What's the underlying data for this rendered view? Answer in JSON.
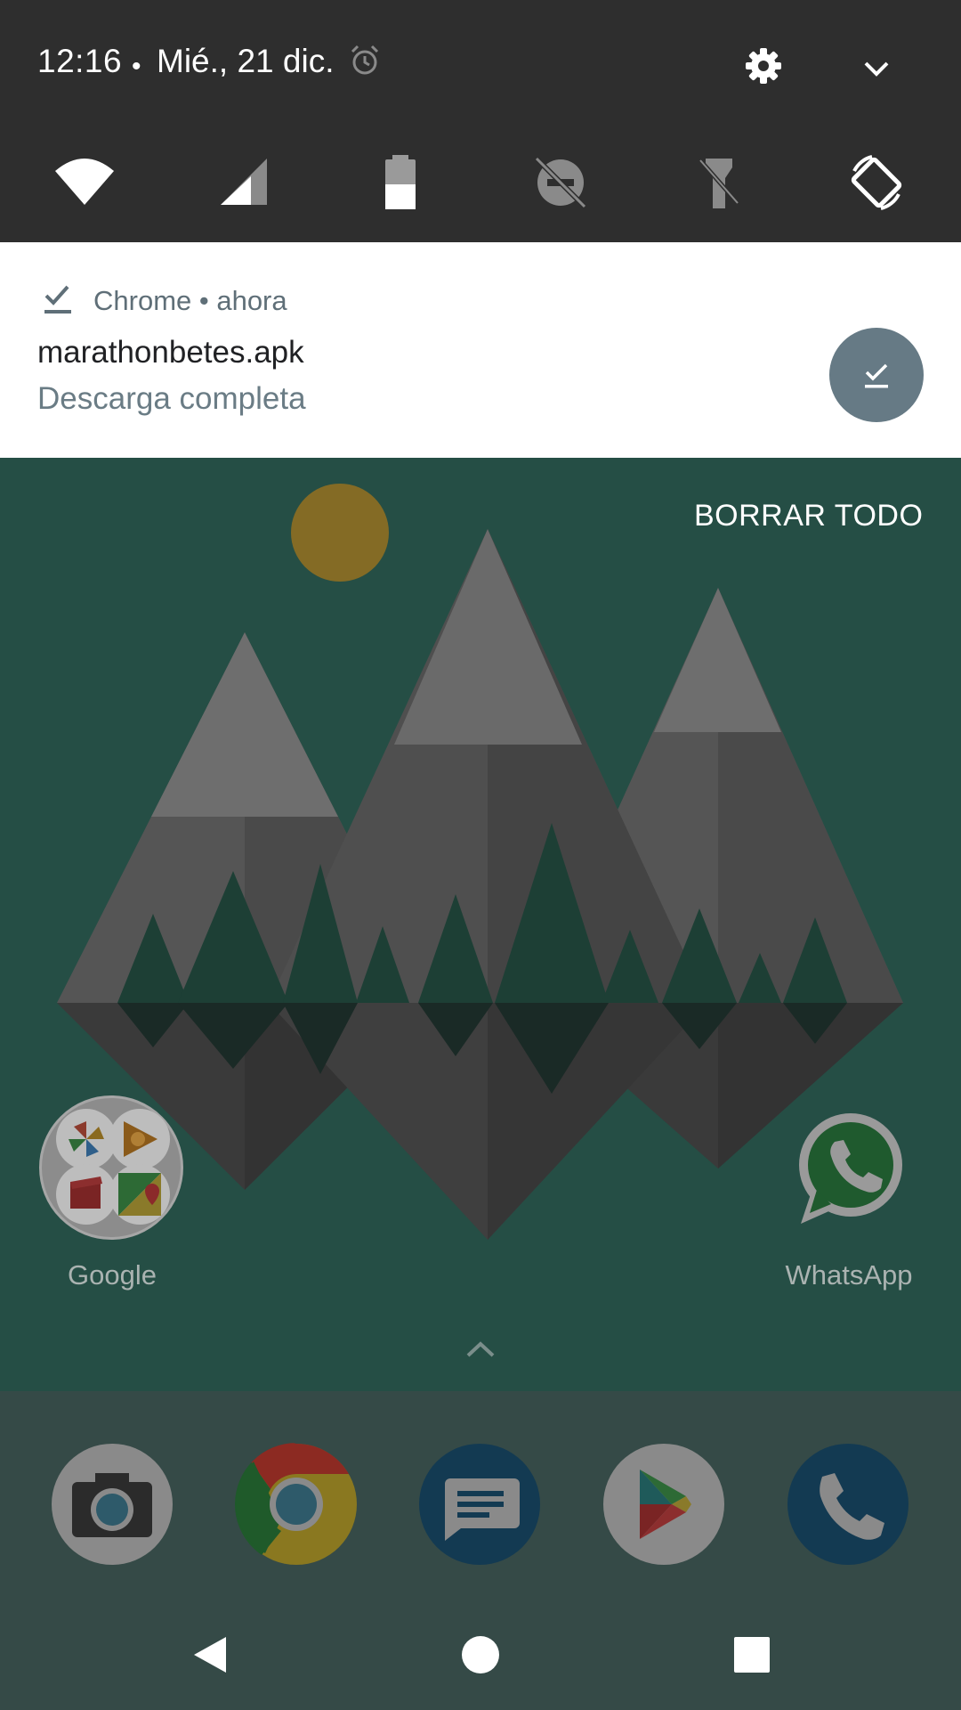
{
  "status": {
    "time": "12:16",
    "separator": "•",
    "date": "Mié., 21 dic."
  },
  "quick_settings": {
    "icons": [
      "alarm-icon",
      "settings-gear-icon",
      "expand-chevron-icon"
    ],
    "tiles": [
      {
        "name": "wifi",
        "icon": "wifi-icon"
      },
      {
        "name": "cellular-signal",
        "icon": "cell-signal-icon"
      },
      {
        "name": "battery",
        "icon": "battery-icon",
        "level": 0.5
      },
      {
        "name": "do-not-disturb",
        "icon": "dnd-off-icon"
      },
      {
        "name": "flashlight",
        "icon": "flashlight-icon"
      },
      {
        "name": "auto-rotate",
        "icon": "auto-rotate-icon"
      }
    ]
  },
  "notification": {
    "app_line": "Chrome • ahora",
    "title": "marathonbetes.apk",
    "subtitle": "Descarga completa",
    "icon": "download-done-icon"
  },
  "clear_all": "BORRAR TODO",
  "home": {
    "folder_label": "Google",
    "whatsapp_label": "WhatsApp"
  },
  "dock": [
    "camera-icon",
    "chrome-icon",
    "messages-icon",
    "play-store-icon",
    "phone-icon"
  ],
  "nav": [
    "back-icon",
    "home-icon",
    "recents-icon"
  ],
  "colors": {
    "header": "#2e2e2e",
    "wallpaper": "#254e45",
    "notification_action": "#667a85",
    "dock": "#354a47"
  }
}
